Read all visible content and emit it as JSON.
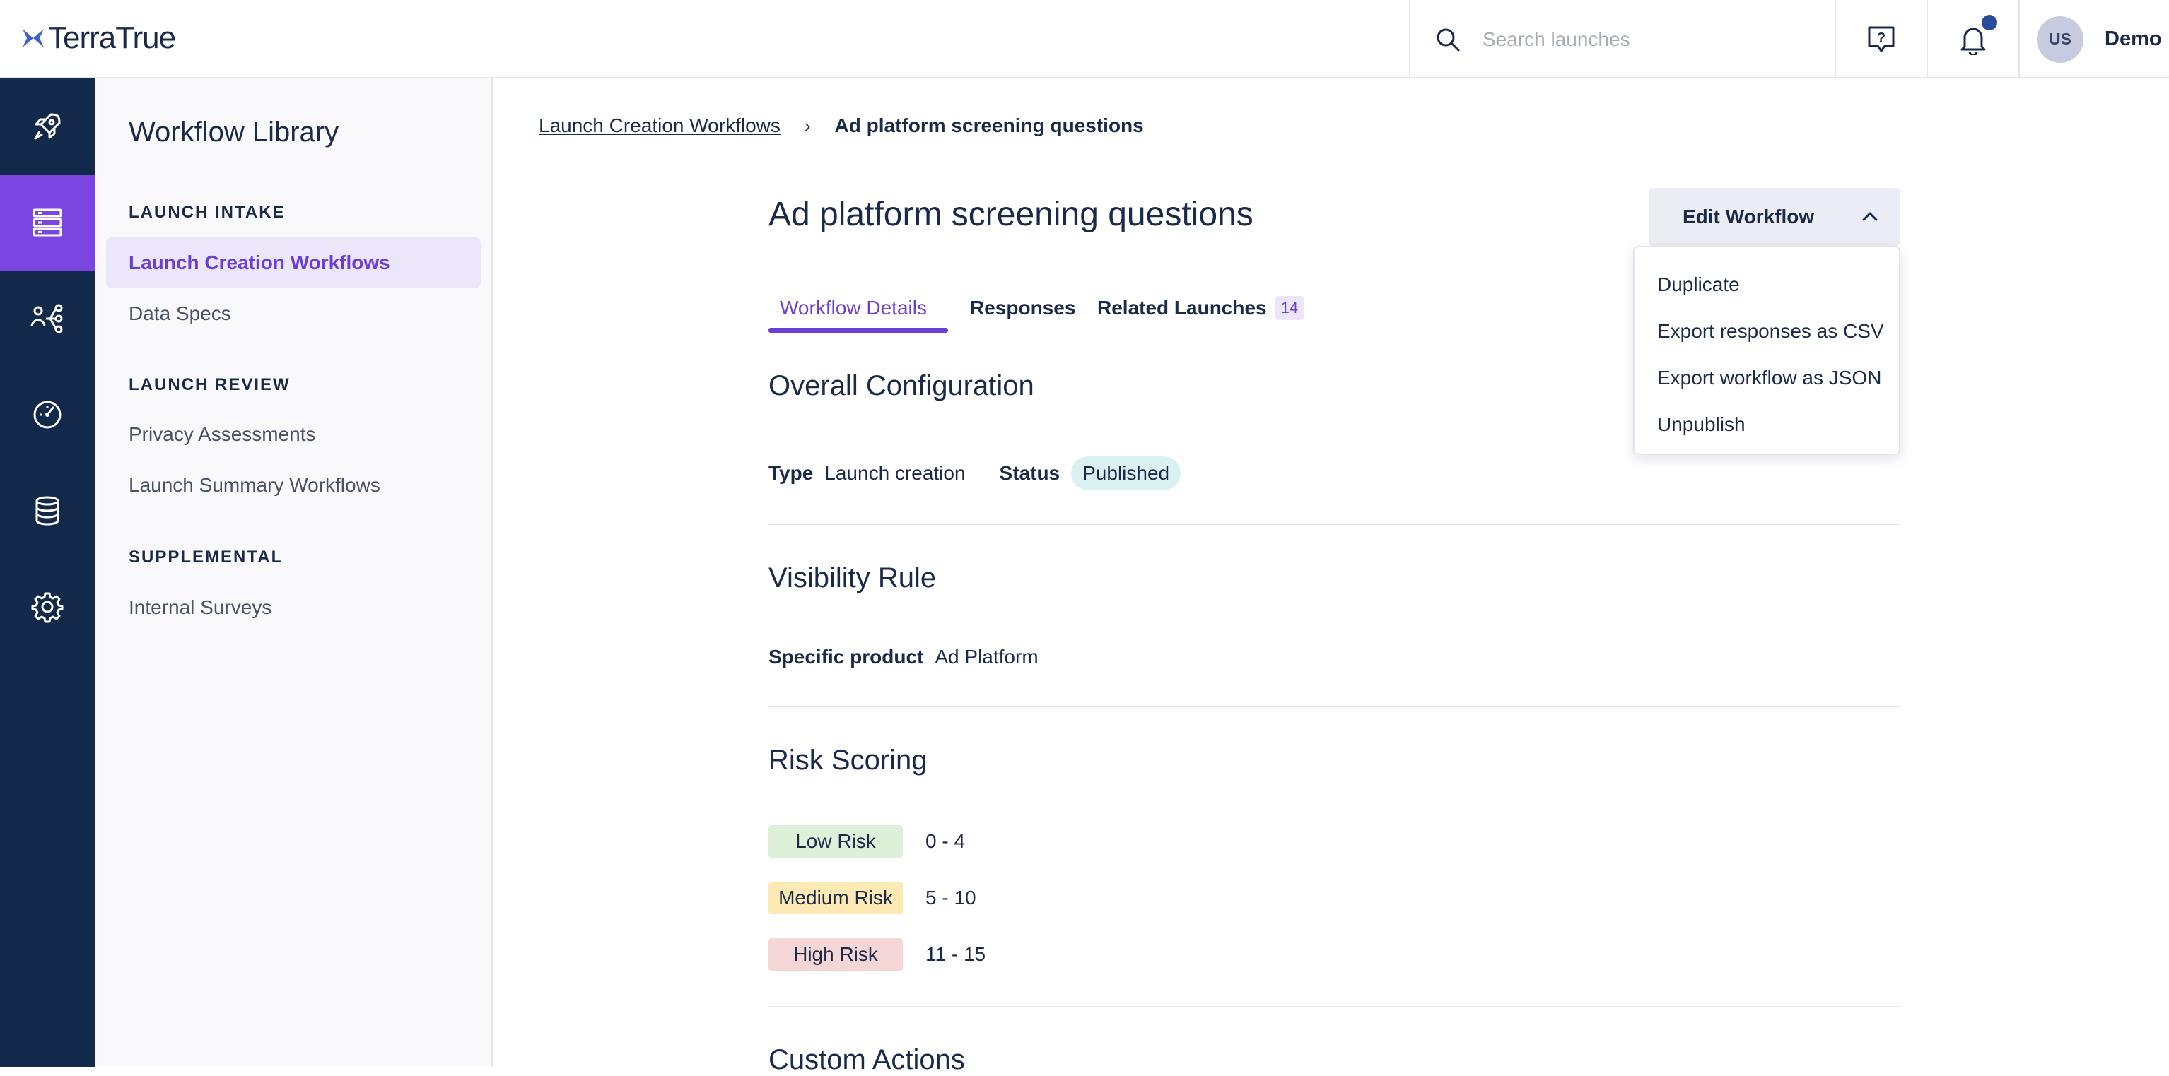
{
  "brand": {
    "logo_text": "TerraTrue"
  },
  "search": {
    "placeholder": "Search launches"
  },
  "user": {
    "initials": "US",
    "name": "Demo"
  },
  "rail": {
    "items": [
      "rocket-icon",
      "list-icon",
      "flow-icon",
      "gauge-icon",
      "database-icon",
      "gear-icon"
    ],
    "active_index": 1
  },
  "sidenav": {
    "title": "Workflow Library",
    "sections": [
      {
        "heading": "LAUNCH INTAKE",
        "items": [
          {
            "label": "Launch Creation Workflows",
            "active": true
          },
          {
            "label": "Data Specs"
          }
        ]
      },
      {
        "heading": "LAUNCH REVIEW",
        "items": [
          {
            "label": "Privacy Assessments"
          },
          {
            "label": "Launch Summary Workflows"
          }
        ]
      },
      {
        "heading": "SUPPLEMENTAL",
        "items": [
          {
            "label": "Internal Surveys"
          }
        ]
      }
    ]
  },
  "breadcrumb": {
    "parent": "Launch Creation Workflows",
    "separator": "›",
    "current": "Ad platform screening questions"
  },
  "page": {
    "title": "Ad platform screening questions"
  },
  "edit_button": {
    "label": "Edit Workflow"
  },
  "menu": {
    "items": [
      "Duplicate",
      "Export responses as CSV",
      "Export workflow as JSON",
      "Unpublish"
    ]
  },
  "tabs": [
    {
      "label": "Workflow Details",
      "active": true
    },
    {
      "label": "Responses"
    },
    {
      "label": "Related Launches",
      "count": "14"
    }
  ],
  "overall": {
    "heading": "Overall Configuration",
    "type_label": "Type",
    "type_value": "Launch creation",
    "status_label": "Status",
    "status_value": "Published"
  },
  "visibility": {
    "heading": "Visibility Rule",
    "label": "Specific product",
    "value": "Ad Platform"
  },
  "risk": {
    "heading": "Risk Scoring",
    "rows": [
      {
        "label": "Low Risk",
        "range": "0 - 4",
        "color": "#dff0d8"
      },
      {
        "label": "Medium Risk",
        "range": "5 - 10",
        "color": "#fce9b4"
      },
      {
        "label": "High Risk",
        "range": "11 - 15",
        "color": "#f5d6d6"
      }
    ]
  },
  "custom_actions": {
    "heading": "Custom Actions"
  },
  "colors": {
    "accent": "#6b3fd4",
    "rail": "#13294b",
    "rail_active": "#7a45e0"
  }
}
